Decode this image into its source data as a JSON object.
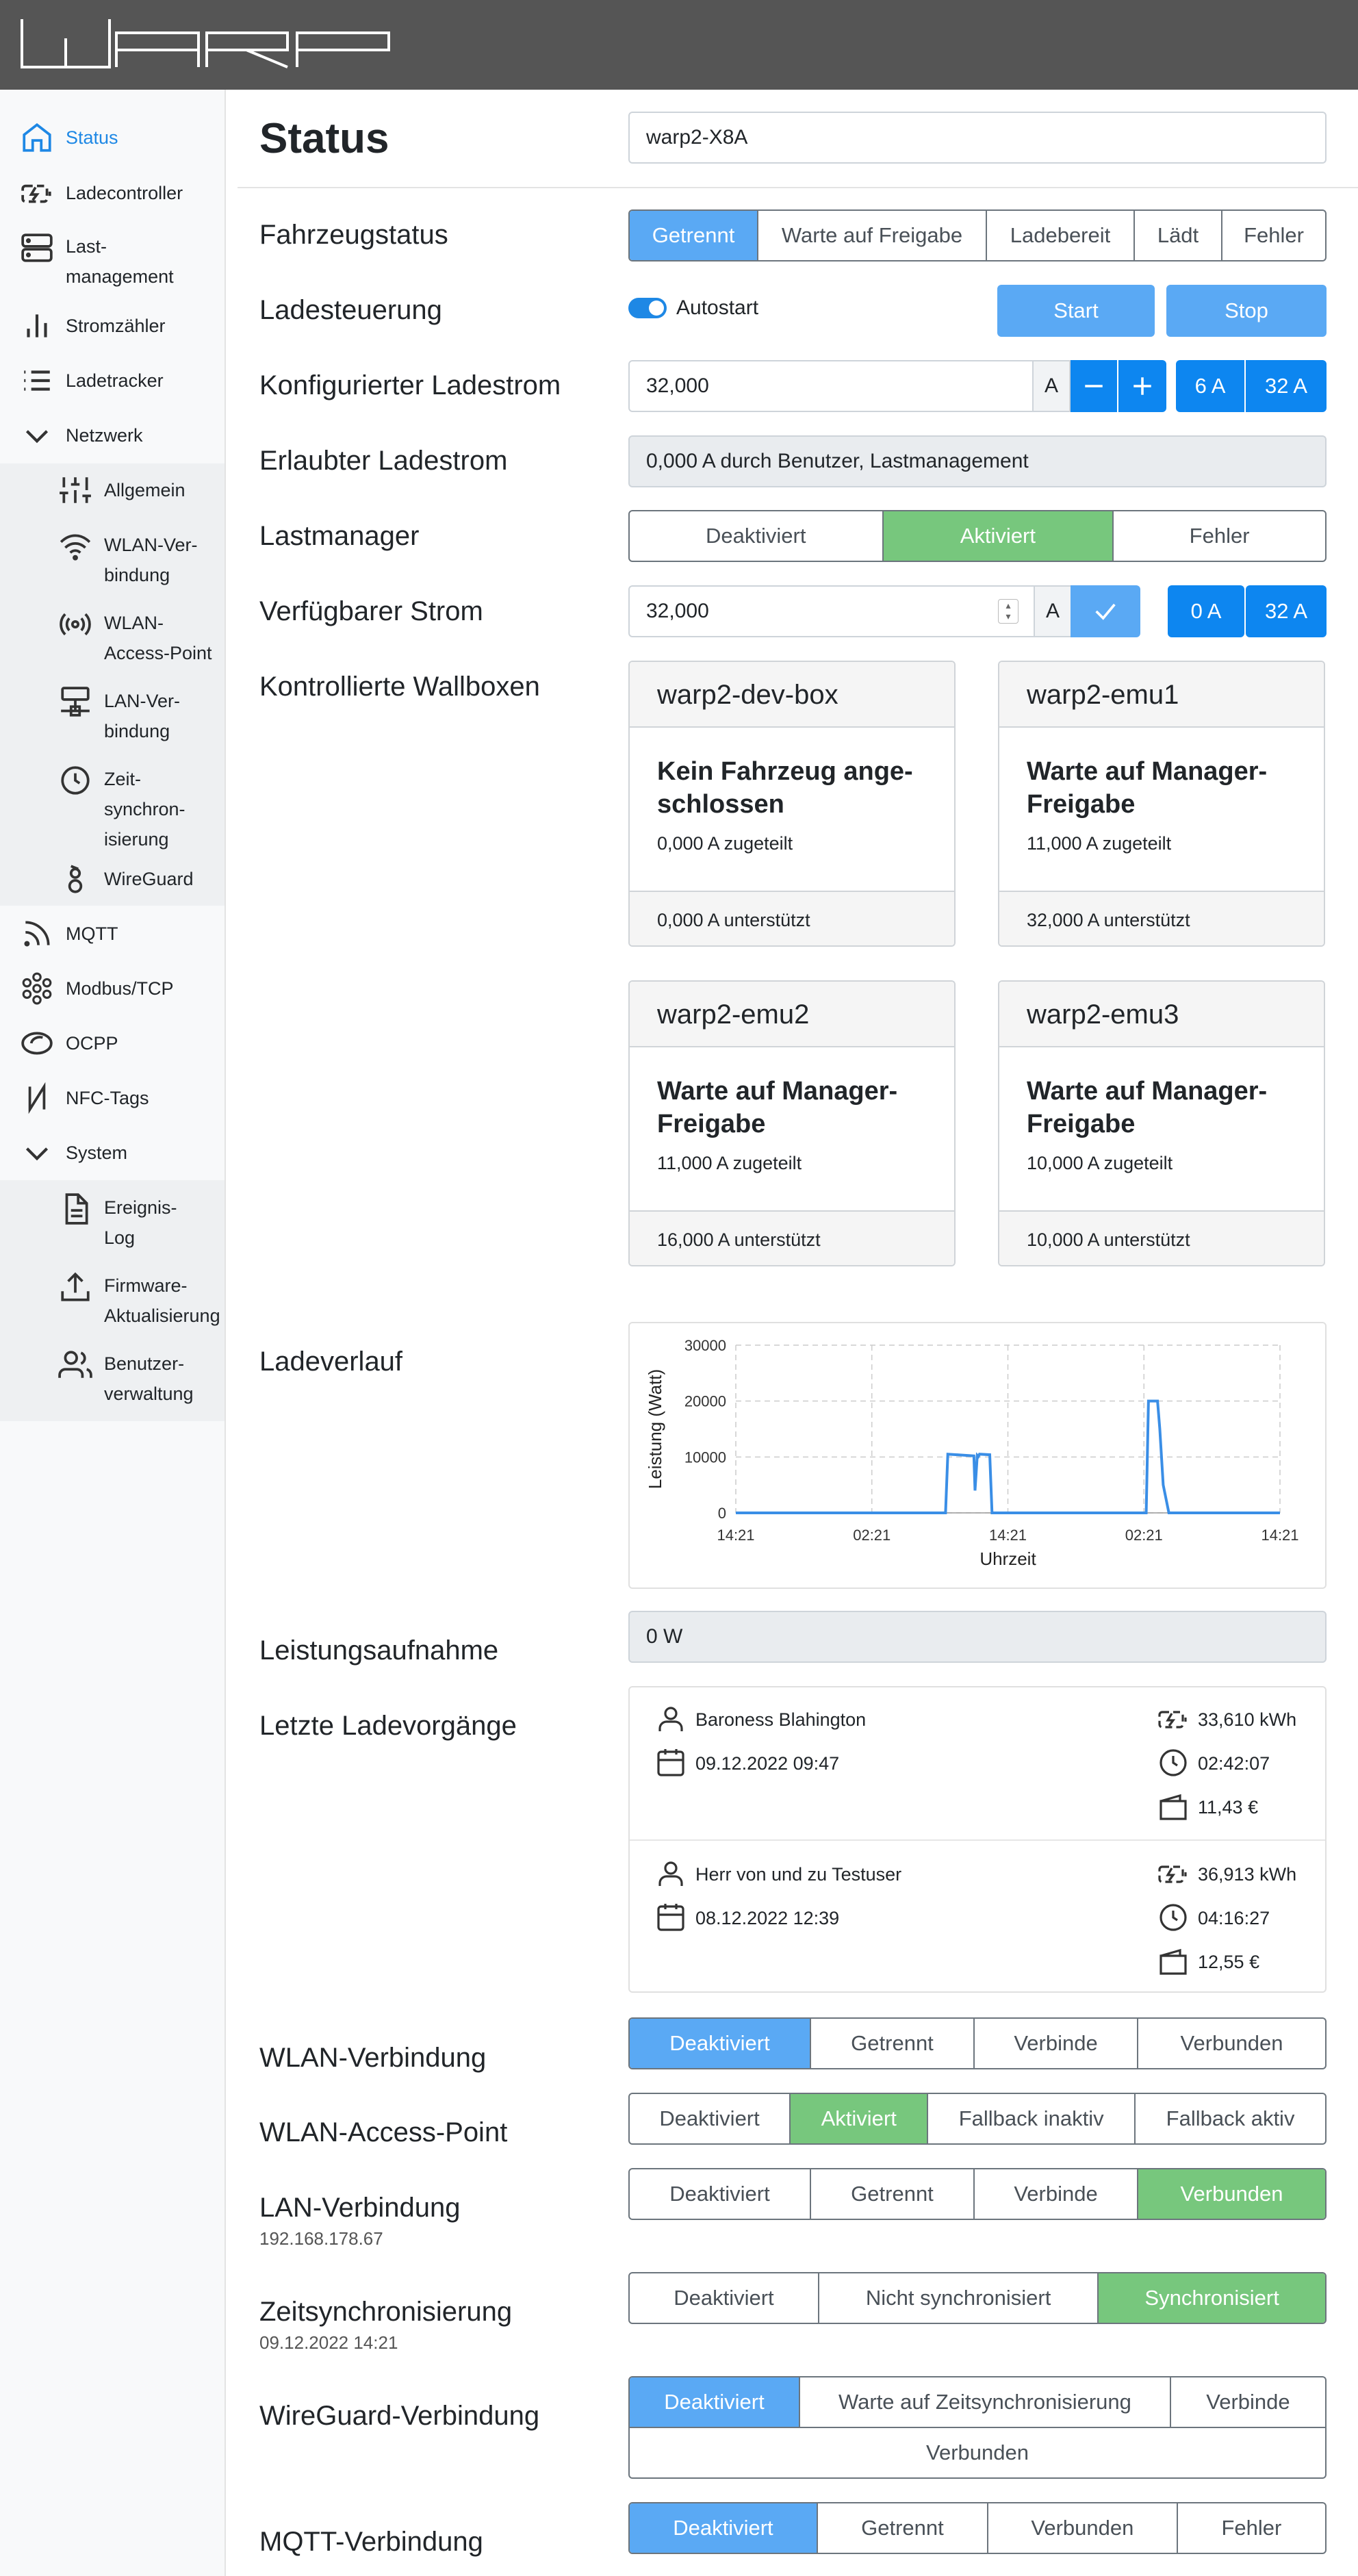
{
  "header": {
    "logo_icon": "warp-logo"
  },
  "sidebar": {
    "items": [
      {
        "label": "Status",
        "icon": "home-icon"
      },
      {
        "label": "Ladecontroller",
        "icon": "charger-icon"
      },
      {
        "label": "Last-\nmanagement",
        "icon": "server-icon"
      },
      {
        "label": "Stromzähler",
        "icon": "bar-chart-icon"
      },
      {
        "label": "Ladetracker",
        "icon": "list-icon"
      },
      {
        "label": "Netzwerk",
        "icon": "chevron-down-icon"
      },
      {
        "label": "Allgemein",
        "icon": "sliders-icon"
      },
      {
        "label": "WLAN-Ver-\nbindung",
        "icon": "wifi-icon"
      },
      {
        "label": "WLAN-\nAccess-Point",
        "icon": "radio-icon"
      },
      {
        "label": "LAN-Ver-\nbindung",
        "icon": "network-icon"
      },
      {
        "label": "Zeit-\nsynchron-\nisierung",
        "icon": "clock-icon"
      },
      {
        "label": "WireGuard",
        "icon": "wireguard-icon"
      },
      {
        "label": "MQTT",
        "icon": "rss-icon"
      },
      {
        "label": "Modbus/TCP",
        "icon": "modbus-icon"
      },
      {
        "label": "OCPP",
        "icon": "ocpp-icon"
      },
      {
        "label": "NFC-Tags",
        "icon": "nfc-icon"
      },
      {
        "label": "System",
        "icon": "chevron-down-icon"
      },
      {
        "label": "Ereignis-\nLog",
        "icon": "file-text-icon"
      },
      {
        "label": "Firmware-\nAktualisierung",
        "icon": "upload-icon"
      },
      {
        "label": "Benutzer-\nverwaltung",
        "icon": "users-icon"
      }
    ]
  },
  "main": {
    "title": "Status",
    "device_name": "warp2-X8A",
    "fahrzeugstatus": {
      "label": "Fahrzeugstatus",
      "options": [
        "Getrennt",
        "Warte auf Freigabe",
        "Ladebereit",
        "Lädt",
        "Fehler"
      ]
    },
    "ladesteuerung": {
      "label": "Ladesteuerung",
      "autostart_label": "Autostart",
      "start_label": "Start",
      "stop_label": "Stop"
    },
    "konfigurierter_ladestrom": {
      "label": "Konfigurierter Ladestrom",
      "value": "32,000",
      "unit": "A",
      "minus": "−",
      "plus": "+",
      "min_btn": "6 A",
      "max_btn": "32 A"
    },
    "erlaubter_ladestrom": {
      "label": "Erlaubter Ladestrom",
      "value": "0,000 A durch Benutzer, Lastmanagement"
    },
    "lastmanager": {
      "label": "Lastmanager",
      "options": [
        "Deaktiviert",
        "Aktiviert",
        "Fehler"
      ]
    },
    "verfuegbarer_strom": {
      "label": "Verfügbarer Strom",
      "value": "32,000",
      "unit": "A",
      "zero_btn": "0 A",
      "max_btn": "32 A"
    },
    "kontrollierte_wallboxen": {
      "label": "Kontrollierte Wallboxen",
      "boxes": [
        {
          "name": "warp2-dev-box",
          "state": "Kein Fahrzeug ange-\nschlossen",
          "assigned": "0,000 A zugeteilt",
          "supported": "0,000 A unterstützt"
        },
        {
          "name": "warp2-emu1",
          "state": "Warte auf Manager-\nFreigabe",
          "assigned": "11,000 A zugeteilt",
          "supported": "32,000 A unterstützt"
        },
        {
          "name": "warp2-emu2",
          "state": "Warte auf Manager-\nFreigabe",
          "assigned": "11,000 A zugeteilt",
          "supported": "16,000 A unterstützt"
        },
        {
          "name": "warp2-emu3",
          "state": "Warte auf Manager-\nFreigabe",
          "assigned": "10,000 A zugeteilt",
          "supported": "10,000 A unterstützt"
        }
      ]
    },
    "ladeverlauf": {
      "label": "Ladeverlauf"
    },
    "leistungsaufnahme": {
      "label": "Leistungsaufnahme",
      "value": "0 W"
    },
    "letzte_ladevorgaenge": {
      "label": "Letzte Ladevorgänge",
      "entries": [
        {
          "user": "Baroness Blahington",
          "date": "09.12.2022 09:47",
          "energy": "33,610 kWh",
          "duration": "02:42:07",
          "cost": "11,43 €"
        },
        {
          "user": "Herr von und zu Testuser",
          "date": "08.12.2022 12:39",
          "energy": "36,913 kWh",
          "duration": "04:16:27",
          "cost": "12,55 €"
        }
      ]
    },
    "wlan_verbindung": {
      "label": "WLAN-Verbindung",
      "options": [
        "Deaktiviert",
        "Getrennt",
        "Verbinde",
        "Verbunden"
      ]
    },
    "wlan_ap": {
      "label": "WLAN-Access-Point",
      "options": [
        "Deaktiviert",
        "Aktiviert",
        "Fallback inaktiv",
        "Fallback aktiv"
      ]
    },
    "lan_verbindung": {
      "label": "LAN-Verbindung",
      "sub": "192.168.178.67",
      "options": [
        "Deaktiviert",
        "Getrennt",
        "Verbinde",
        "Verbunden"
      ]
    },
    "zeitsync": {
      "label": "Zeitsynchronisierung",
      "sub": "09.12.2022 14:21",
      "options": [
        "Deaktiviert",
        "Nicht synchronisiert",
        "Synchronisiert"
      ]
    },
    "wireguard": {
      "label": "WireGuard-Verbindung",
      "options": [
        "Deaktiviert",
        "Warte auf Zeitsynchronisierung",
        "Verbinde"
      ],
      "extra": "Verbunden"
    },
    "mqtt": {
      "label": "MQTT-Verbindung",
      "options": [
        "Deaktiviert",
        "Getrennt",
        "Verbunden",
        "Fehler"
      ]
    }
  },
  "chart_data": {
    "type": "line",
    "xlabel": "Uhrzeit",
    "ylabel": "Leistung (Watt)",
    "x_tick_labels": [
      "14:21",
      "02:21",
      "14:21",
      "02:21",
      "14:21"
    ],
    "y_ticks": [
      0,
      10000,
      20000,
      30000
    ],
    "ylim": [
      0,
      30000
    ],
    "xlim_hours": [
      0,
      48
    ],
    "grid": true,
    "color": "#3a8ee6",
    "series": [
      {
        "x_hours": [
          0,
          18.5,
          18.7,
          21.0,
          21.1,
          21.3,
          21.4,
          21.5,
          22.4,
          22.6,
          36.2,
          36.4,
          37.2,
          37.4,
          37.7,
          38.2,
          48
        ],
        "values": [
          0,
          0,
          10500,
          10200,
          4000,
          10300,
          10100,
          10500,
          10400,
          0,
          0,
          20000,
          20000,
          15000,
          5000,
          0,
          0
        ]
      }
    ]
  }
}
